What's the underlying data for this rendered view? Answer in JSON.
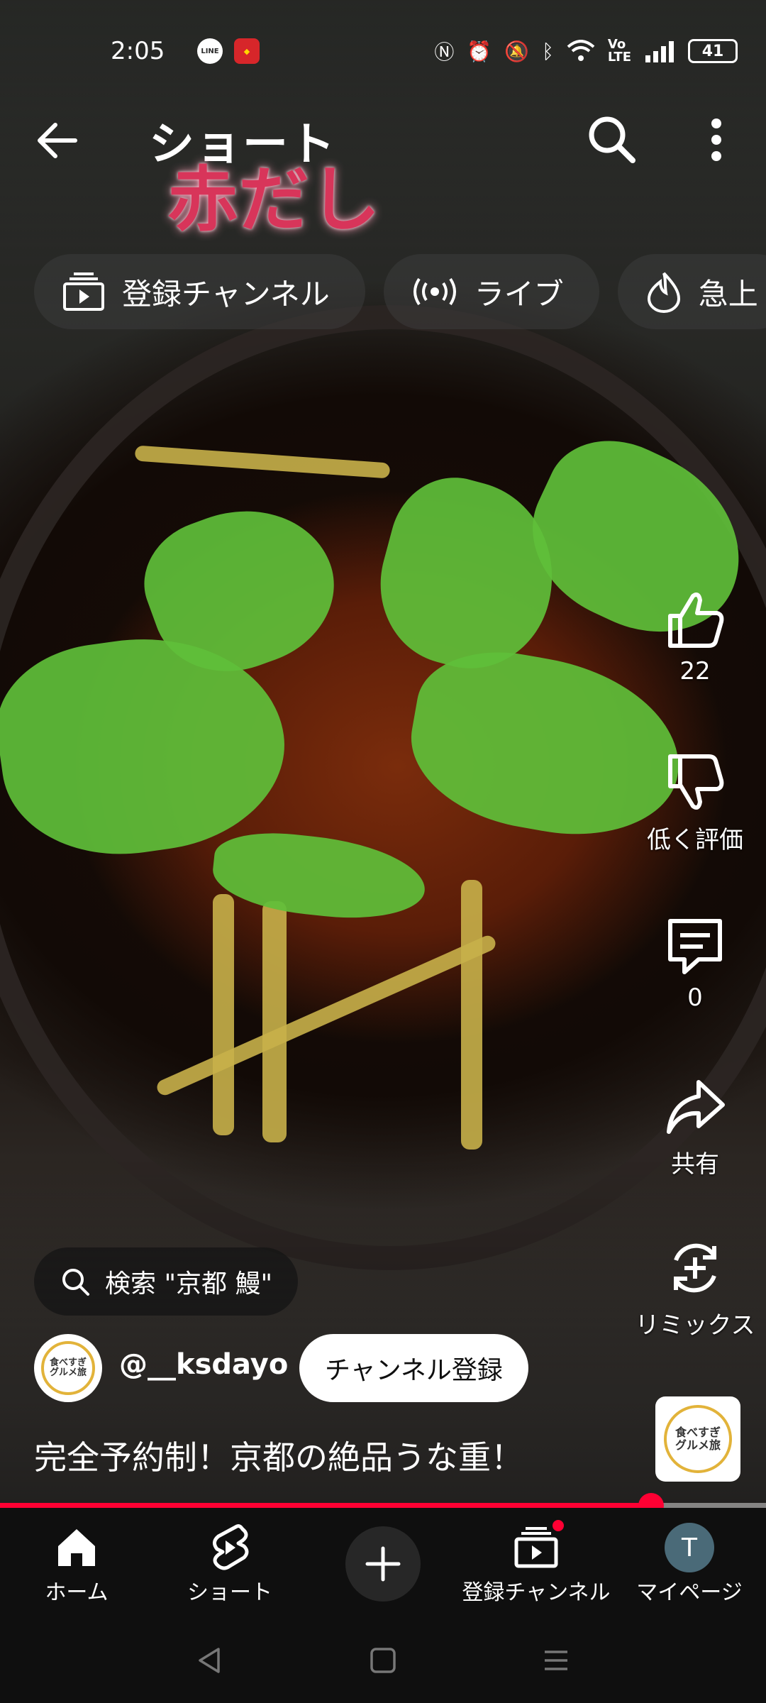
{
  "status_bar": {
    "time": "2:05",
    "apps": [
      "LINE",
      "app"
    ],
    "battery": "41",
    "right_icons": [
      "nfc-icon",
      "alarm-icon",
      "mute-icon",
      "bluetooth-icon",
      "wifi-icon",
      "volte-icon",
      "signal-icon"
    ]
  },
  "header": {
    "title": "ショート",
    "back_icon": "arrow-left-icon",
    "search_icon": "search-icon",
    "more_icon": "more-vert-icon"
  },
  "video": {
    "overlay_text": "赤だし"
  },
  "chips": [
    {
      "label": "登録チャンネル",
      "icon": "subscriptions-icon"
    },
    {
      "label": "ライブ",
      "icon": "live-icon"
    },
    {
      "label": "急上",
      "icon": "trending-icon"
    }
  ],
  "actions": {
    "like_count": "22",
    "dislike_label": "低く評価",
    "comment_count": "0",
    "share_label": "共有",
    "remix_label": "リミックス"
  },
  "search_suggestion": "検索 \"京都 鰻\"",
  "channel": {
    "handle": "@__ksdayo",
    "subscribe_label": "チャンネル登録",
    "avatar_text": [
      "食べすぎ",
      "グルメ旅"
    ]
  },
  "caption": "完全予約制！京都の絶品うな重！",
  "progress": {
    "fraction": 0.85
  },
  "nav": {
    "items": [
      {
        "label": "ホーム",
        "icon": "home-icon"
      },
      {
        "label": "ショート",
        "icon": "shorts-icon"
      },
      {
        "label": "",
        "icon": "plus-icon"
      },
      {
        "label": "登録チャンネル",
        "icon": "subscriptions-icon"
      },
      {
        "label": "マイページ",
        "icon": "avatar"
      }
    ],
    "avatar_letter": "T"
  },
  "colors": {
    "accent": "#ff0033",
    "background": "#0f0f0f",
    "overlay_text": "#d8355a"
  }
}
